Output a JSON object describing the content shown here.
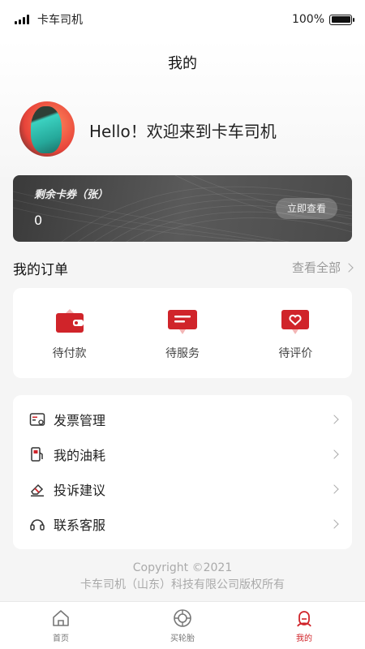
{
  "status_bar": {
    "carrier": "卡车司机",
    "battery": "100%"
  },
  "page": {
    "title": "我的"
  },
  "profile": {
    "greeting": "Hello！欢迎来到卡车司机"
  },
  "coupon": {
    "label": "剩余卡券（张）",
    "count": "0",
    "button": "立即查看"
  },
  "orders": {
    "title": "我的订单",
    "view_all": "查看全部",
    "items": [
      {
        "label": "待付款",
        "icon": "wallet-icon"
      },
      {
        "label": "待服务",
        "icon": "message-icon"
      },
      {
        "label": "待评价",
        "icon": "heart-message-icon"
      }
    ]
  },
  "menu": {
    "items": [
      {
        "label": "发票管理",
        "icon": "invoice-icon"
      },
      {
        "label": "我的油耗",
        "icon": "fuel-icon"
      },
      {
        "label": "投诉建议",
        "icon": "eraser-icon"
      },
      {
        "label": "联系客服",
        "icon": "headset-icon"
      }
    ]
  },
  "footer": {
    "copyright_line1": "Copyright ©2021",
    "copyright_line2": "卡车司机（山东）科技有限公司版权所有"
  },
  "tab_bar": {
    "tabs": [
      {
        "label": "首页",
        "icon": "home-icon",
        "active": false
      },
      {
        "label": "买轮胎",
        "icon": "tire-icon",
        "active": false
      },
      {
        "label": "我的",
        "icon": "user-icon",
        "active": true
      }
    ]
  },
  "colors": {
    "accent": "#d0242a",
    "card_dark": "#4a4a4a",
    "background": "#f5f5f5"
  }
}
